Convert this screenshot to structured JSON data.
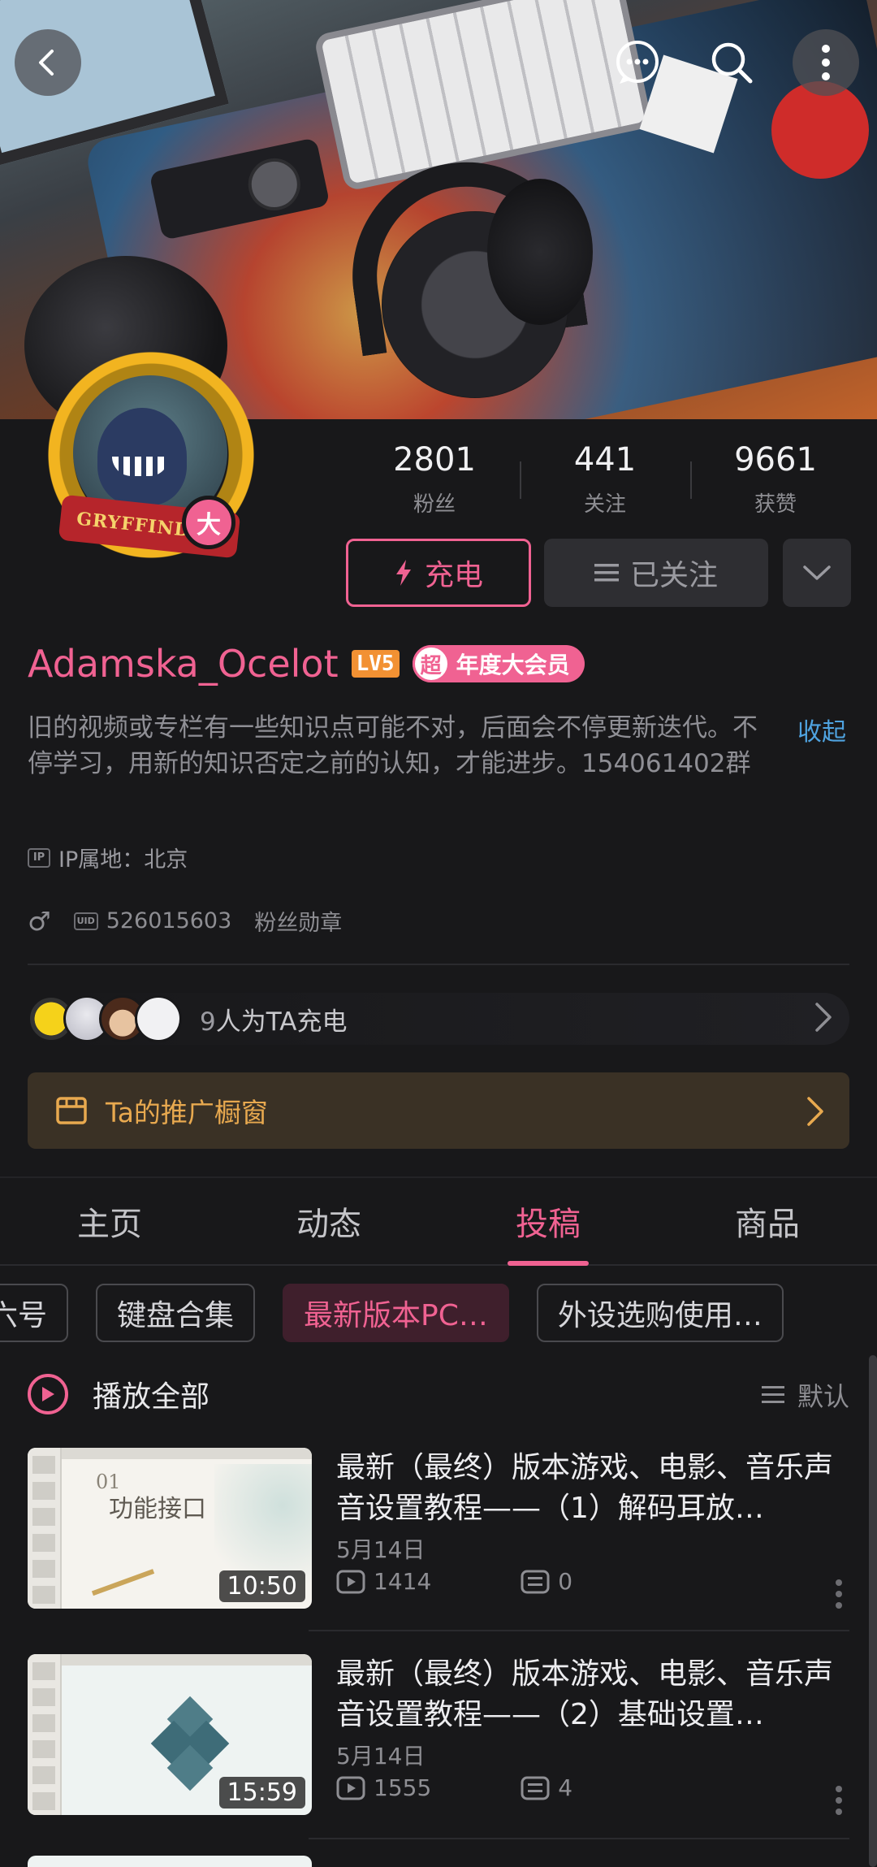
{
  "profile": {
    "stats": [
      {
        "num": "2801",
        "label": "粉丝"
      },
      {
        "num": "441",
        "label": "关注"
      },
      {
        "num": "9661",
        "label": "获赞"
      }
    ],
    "charge_label": "充电",
    "follow_label": "已关注",
    "name": "Adamska_Ocelot",
    "level": "LV5",
    "vip_chip": "超",
    "vip_label": "年度大会员",
    "avatar_badge": "大",
    "avatar_ribbon": "GRYFFINDOR",
    "bio": "旧的视频或专栏有一些知识点可能不对，后面会不停更新迭代。不停学习，用新的知识否定之前的认知，才能进步。154061402群",
    "collapse_label": "收起",
    "ip_icon": "IP",
    "ip_text": "IP属地：北京",
    "gender_icon": "♂",
    "uid_icon": "UID",
    "uid": "526015603",
    "fan_medal": "粉丝勋章",
    "charge_count": "9",
    "charge_text": "人为TA充电",
    "showcase_label": "Ta的推广橱窗"
  },
  "tabs": [
    {
      "label": "主页"
    },
    {
      "label": "动态"
    },
    {
      "label": "投稿",
      "active": true
    },
    {
      "label": "商品"
    }
  ],
  "chips": [
    {
      "label": "六号"
    },
    {
      "label": "键盘合集"
    },
    {
      "label": "最新版本PC…",
      "active": true
    },
    {
      "label": "外设选购使用…"
    }
  ],
  "playall": {
    "label": "播放全部",
    "sort_label": "默认"
  },
  "videos": [
    {
      "title": "最新（最终）版本游戏、电影、音乐声音设置教程——（1）解码耳放…",
      "date": "5月14日",
      "plays": "1414",
      "comments": "0",
      "duration": "10:50",
      "slide_num": "01",
      "slide_title": "功能接口"
    },
    {
      "title": "最新（最终）版本游戏、电影、音乐声音设置教程——（2）基础设置…",
      "date": "5月14日",
      "plays": "1555",
      "comments": "4",
      "duration": "15:59"
    }
  ],
  "colors": {
    "accent": "#f06292",
    "link": "#4fa3e0",
    "showcase": "#e8a94f",
    "background": "#18181a"
  }
}
